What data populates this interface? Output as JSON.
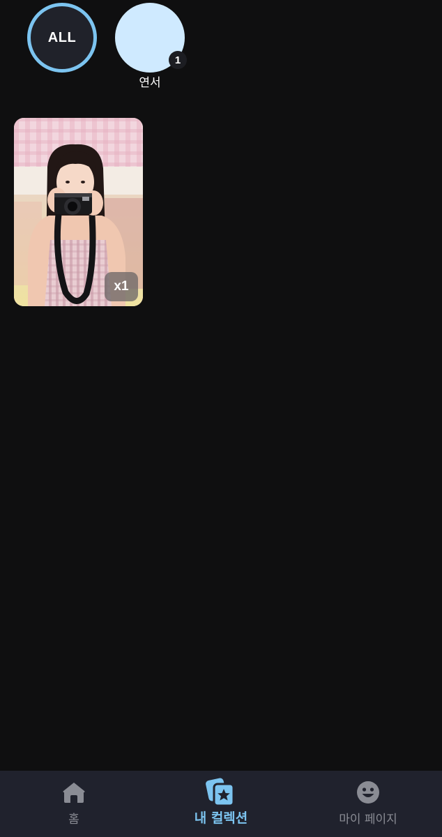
{
  "filters": {
    "all_label": "ALL",
    "members": [
      {
        "name": "연서",
        "count": "1",
        "color": "#cfeaff"
      }
    ],
    "selected": "ALL",
    "selected_ring_color": "#7cc4f0"
  },
  "cards": [
    {
      "quantity": "x1",
      "image_icon": "photocard-camera-photo"
    }
  ],
  "bottom_nav": {
    "items": [
      {
        "label": "홈",
        "icon": "home-icon",
        "active": false
      },
      {
        "label": "내 컬렉션",
        "icon": "collection-icon",
        "active": true
      },
      {
        "label": "마이 페이지",
        "icon": "smiley-face-icon",
        "active": false
      }
    ],
    "active_color": "#7cc4f0",
    "inactive_color": "#8a8c94"
  }
}
